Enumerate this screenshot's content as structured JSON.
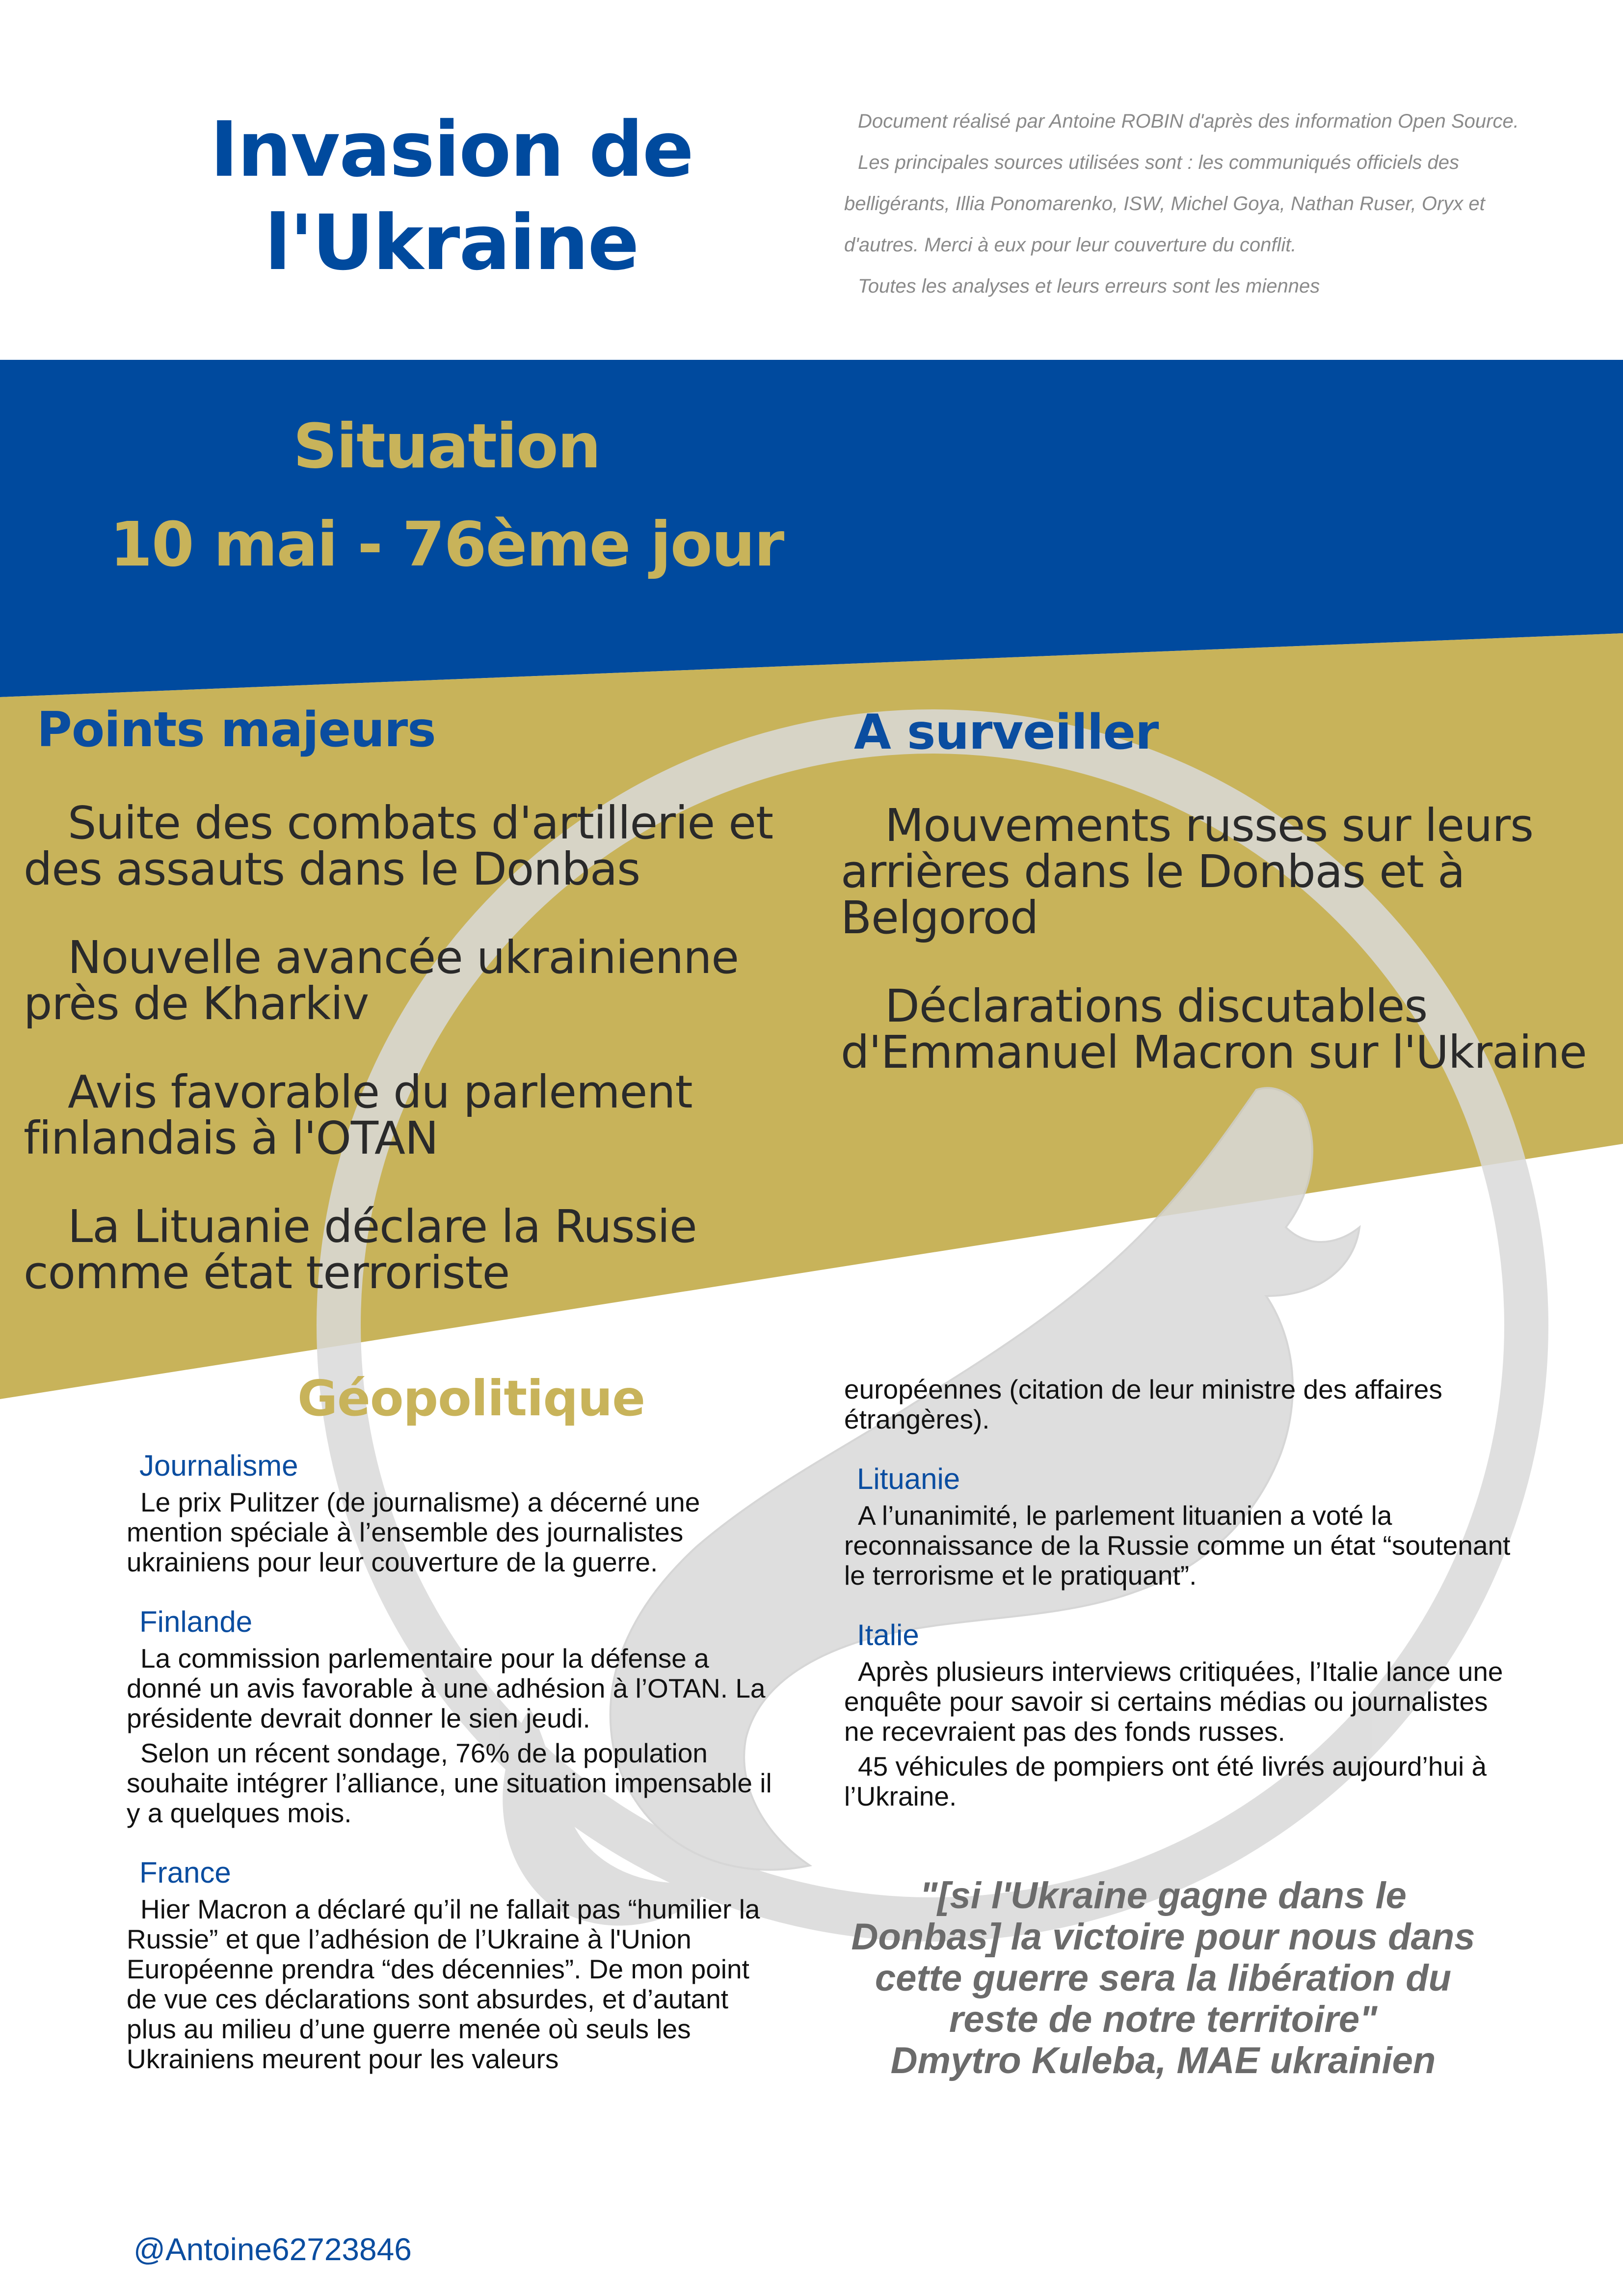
{
  "header": {
    "title_line1": "Invasion de",
    "title_line2": "l'Ukraine",
    "source_lines": [
      "Document réalisé par Antoine ROBIN d'après des information Open Source.",
      "Les principales sources utilisées sont : les communiqués officiels des belligérants, Illia Ponomarenko, ISW, Michel Goya, Nathan Ruser, Oryx et d'autres. Merci à eux pour leur couverture du conflit.",
      "Toutes les analyses et leurs erreurs sont les miennes"
    ]
  },
  "situation": {
    "line1": "Situation",
    "line2": "10 mai - 76ème jour"
  },
  "points_majeurs": {
    "heading": "Points majeurs",
    "items": [
      "Suite des combats d'artillerie et des assauts dans le Donbas",
      "Nouvelle avancée ukrainienne près de Kharkiv",
      "Avis favorable du parlement finlandais à l'OTAN",
      "La Lituanie déclare la Russie comme état terroriste"
    ]
  },
  "a_surveiller": {
    "heading": "A surveiller",
    "items": [
      "Mouvements russes sur leurs arrières dans le Donbas et à Belgorod",
      "Déclarations discutables d'Emmanuel Macron sur l'Ukraine"
    ]
  },
  "geopolitique": {
    "heading": "Géopolitique",
    "journalisme": {
      "title": "Journalisme",
      "text": "Le prix Pulitzer (de journalisme) a décerné une mention spéciale à l’ensemble des journalistes ukrainiens pour leur couverture de la guerre."
    },
    "finlande": {
      "title": "Finlande",
      "text1": "La commission parlementaire pour la défense a donné un avis favorable à une adhésion à l’OTAN. La présidente devrait donner le sien jeudi.",
      "text2": "Selon un récent sondage, 76% de la population souhaite intégrer l’alliance, une situation impensable il y a quelques mois."
    },
    "france": {
      "title": "France",
      "text": "Hier Macron a déclaré qu’il ne fallait pas “humilier la Russie” et que l’adhésion de l’Ukraine à l'Union Européenne prendra “des décennies”. De mon point de vue ces déclarations sont absurdes, et d’autant plus au milieu d’une guerre menée où seuls les Ukrainiens meurent pour les valeurs"
    },
    "france_continued": "européennes (citation de leur ministre des affaires étrangères).",
    "lituanie": {
      "title": "Lituanie",
      "text": "A l’unanimité, le parlement lituanien a voté la reconnaissance de la Russie comme un état “soutenant le terrorisme et le pratiquant”."
    },
    "italie": {
      "title": "Italie",
      "text1": "Après plusieurs interviews critiquées, l’Italie lance une enquête pour savoir si certains médias ou journalistes ne recevraient pas des fonds russes.",
      "text2": "45 véhicules de pompiers ont été livrés aujourd’hui à l’Ukraine."
    }
  },
  "quote": {
    "text": "\"[si l'Ukraine gagne dans le Donbas] la victoire pour nous dans cette guerre sera la libération du reste de notre territoire\"",
    "author": "Dmytro Kuleba, MAE ukrainien"
  },
  "footer": {
    "handle": "@Antoine62723846"
  },
  "colors": {
    "ukraine_blue": "#004a9e",
    "gold": "#c8b35a",
    "watermark_gray": "#dcdcdc"
  }
}
